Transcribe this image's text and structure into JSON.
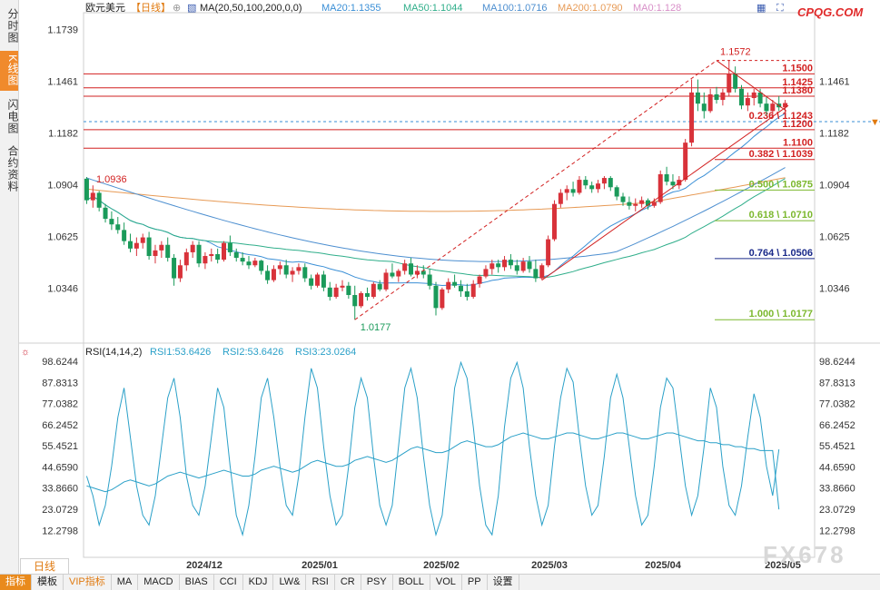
{
  "header": {
    "symbol": "欧元美元",
    "period_label": "【日线】",
    "ma_label": "MA(20,50,100,200,0,0)",
    "ma_values": [
      "MA20:1.1355",
      "MA50:1.1044",
      "MA100:1.0716",
      "MA200:1.0790",
      "MA0:1.128"
    ],
    "logo": "CPQG.COM",
    "rsi_label": "RSI(14,14,2)",
    "rsi_values": [
      "RSI1:53.6426",
      "RSI2:53.6426",
      "RSI3:23.0264"
    ]
  },
  "left_tabs": [
    "分时图",
    "K线图",
    "闪电图",
    "合约资料"
  ],
  "period_tab": "日线",
  "toolbar": [
    "指标",
    "模板",
    "VIP指标",
    "MA",
    "MACD",
    "BIAS",
    "CCI",
    "KDJ",
    "LW&",
    "RSI",
    "CR",
    "PSY",
    "BOLL",
    "VOL",
    "PP",
    "设置"
  ],
  "watermark": "FX678",
  "colors": {
    "up": "#d8323a",
    "down": "#1a9a5a",
    "ma20": "#3a8fd6",
    "ma50": "#2fae8a",
    "ma100": "#4d8fd0",
    "ma200": "#e79a55",
    "fib_line": "#d22020",
    "fib_0.5": "#7cb82e",
    "fib_0.764": "#1a2a8a",
    "logo": "#e02a2a",
    "rsi": "#2aa0c8"
  },
  "chart_data": [
    {
      "type": "candlestick",
      "title": "欧元美元 日线",
      "x_labels": [
        "2024/12",
        "2025/01",
        "2025/02",
        "2025/03",
        "2025/04",
        "2025/05"
      ],
      "y_ticks": [
        "1.1739",
        "1.1461",
        "1.1182",
        "1.0904",
        "1.0625",
        "1.0346"
      ],
      "ylim": [
        1.01,
        1.18
      ],
      "annotations": {
        "high": "1.1572",
        "low": "1.0177",
        "start": "1.0936"
      },
      "ohlc": [
        [
          1.0936,
          1.0945,
          1.08,
          1.082
        ],
        [
          1.082,
          1.09,
          1.078,
          1.086
        ],
        [
          1.086,
          1.087,
          1.076,
          1.078
        ],
        [
          1.078,
          1.08,
          1.07,
          1.072
        ],
        [
          1.072,
          1.076,
          1.066,
          1.069
        ],
        [
          1.069,
          1.073,
          1.064,
          1.066
        ],
        [
          1.066,
          1.07,
          1.058,
          1.06
        ],
        [
          1.06,
          1.064,
          1.054,
          1.056
        ],
        [
          1.056,
          1.062,
          1.052,
          1.059
        ],
        [
          1.059,
          1.064,
          1.056,
          1.062
        ],
        [
          1.062,
          1.065,
          1.05,
          1.052
        ],
        [
          1.052,
          1.058,
          1.048,
          1.055
        ],
        [
          1.055,
          1.06,
          1.051,
          1.058
        ],
        [
          1.058,
          1.062,
          1.049,
          1.051
        ],
        [
          1.051,
          1.053,
          1.036,
          1.04
        ],
        [
          1.04,
          1.05,
          1.038,
          1.047
        ],
        [
          1.047,
          1.056,
          1.044,
          1.054
        ],
        [
          1.054,
          1.06,
          1.051,
          1.058
        ],
        [
          1.058,
          1.06,
          1.046,
          1.048
        ],
        [
          1.048,
          1.054,
          1.045,
          1.052
        ],
        [
          1.052,
          1.056,
          1.049,
          1.053
        ],
        [
          1.053,
          1.056,
          1.048,
          1.05
        ],
        [
          1.05,
          1.06,
          1.049,
          1.059
        ],
        [
          1.059,
          1.063,
          1.052,
          1.054
        ],
        [
          1.054,
          1.056,
          1.049,
          1.051
        ],
        [
          1.051,
          1.054,
          1.047,
          1.049
        ],
        [
          1.049,
          1.052,
          1.045,
          1.047
        ],
        [
          1.047,
          1.051,
          1.046,
          1.0495
        ],
        [
          1.0495,
          1.05,
          1.042,
          1.044
        ],
        [
          1.044,
          1.047,
          1.037,
          1.039
        ],
        [
          1.039,
          1.047,
          1.038,
          1.045
        ],
        [
          1.045,
          1.049,
          1.042,
          1.047
        ],
        [
          1.047,
          1.05,
          1.04,
          1.042
        ],
        [
          1.042,
          1.046,
          1.038,
          1.044
        ],
        [
          1.044,
          1.048,
          1.042,
          1.046
        ],
        [
          1.046,
          1.048,
          1.038,
          1.04
        ],
        [
          1.04,
          1.042,
          1.034,
          1.036
        ],
        [
          1.036,
          1.043,
          1.035,
          1.042
        ],
        [
          1.042,
          1.044,
          1.033,
          1.035
        ],
        [
          1.035,
          1.038,
          1.028,
          1.03
        ],
        [
          1.03,
          1.037,
          1.029,
          1.035
        ],
        [
          1.035,
          1.039,
          1.033,
          1.036
        ],
        [
          1.036,
          1.038,
          1.029,
          1.031
        ],
        [
          1.031,
          1.036,
          1.0177,
          1.025
        ],
        [
          1.025,
          1.033,
          1.024,
          1.032
        ],
        [
          1.032,
          1.035,
          1.028,
          1.03
        ],
        [
          1.03,
          1.038,
          1.029,
          1.037
        ],
        [
          1.037,
          1.039,
          1.033,
          1.034
        ],
        [
          1.034,
          1.045,
          1.033,
          1.043
        ],
        [
          1.043,
          1.048,
          1.04,
          1.041
        ],
        [
          1.041,
          1.045,
          1.038,
          1.044
        ],
        [
          1.044,
          1.05,
          1.042,
          1.048
        ],
        [
          1.048,
          1.051,
          1.041,
          1.042
        ],
        [
          1.042,
          1.047,
          1.04,
          1.044
        ],
        [
          1.044,
          1.047,
          1.04,
          1.042
        ],
        [
          1.042,
          1.045,
          1.034,
          1.036
        ],
        [
          1.036,
          1.038,
          1.02,
          1.024
        ],
        [
          1.024,
          1.035,
          1.023,
          1.034
        ],
        [
          1.034,
          1.04,
          1.032,
          1.038
        ],
        [
          1.038,
          1.042,
          1.035,
          1.036
        ],
        [
          1.036,
          1.039,
          1.03,
          1.033
        ],
        [
          1.033,
          1.037,
          1.028,
          1.03
        ],
        [
          1.03,
          1.039,
          1.029,
          1.037
        ],
        [
          1.037,
          1.042,
          1.035,
          1.041
        ],
        [
          1.041,
          1.047,
          1.04,
          1.045
        ],
        [
          1.045,
          1.05,
          1.042,
          1.048
        ],
        [
          1.048,
          1.05,
          1.043,
          1.046
        ],
        [
          1.046,
          1.052,
          1.044,
          1.05
        ],
        [
          1.05,
          1.053,
          1.045,
          1.047
        ],
        [
          1.047,
          1.05,
          1.042,
          1.044
        ],
        [
          1.044,
          1.051,
          1.043,
          1.049
        ],
        [
          1.049,
          1.052,
          1.043,
          1.045
        ],
        [
          1.045,
          1.05,
          1.038,
          1.04
        ],
        [
          1.04,
          1.048,
          1.039,
          1.047
        ],
        [
          1.047,
          1.063,
          1.046,
          1.061
        ],
        [
          1.061,
          1.082,
          1.06,
          1.08
        ],
        [
          1.08,
          1.088,
          1.078,
          1.086
        ],
        [
          1.086,
          1.09,
          1.082,
          1.088
        ],
        [
          1.088,
          1.092,
          1.084,
          1.086
        ],
        [
          1.086,
          1.095,
          1.085,
          1.093
        ],
        [
          1.093,
          1.095,
          1.088,
          1.09
        ],
        [
          1.09,
          1.092,
          1.086,
          1.088
        ],
        [
          1.088,
          1.093,
          1.086,
          1.091
        ],
        [
          1.091,
          1.095,
          1.088,
          1.094
        ],
        [
          1.094,
          1.095,
          1.087,
          1.089
        ],
        [
          1.089,
          1.09,
          1.082,
          1.084
        ],
        [
          1.084,
          1.086,
          1.079,
          1.081
        ],
        [
          1.081,
          1.084,
          1.077,
          1.079
        ],
        [
          1.079,
          1.083,
          1.076,
          1.08
        ],
        [
          1.08,
          1.084,
          1.078,
          1.082
        ],
        [
          1.082,
          1.083,
          1.077,
          1.079
        ],
        [
          1.079,
          1.083,
          1.078,
          1.081
        ],
        [
          1.081,
          1.098,
          1.08,
          1.096
        ],
        [
          1.096,
          1.1,
          1.09,
          1.092
        ],
        [
          1.092,
          1.096,
          1.088,
          1.09
        ],
        [
          1.09,
          1.095,
          1.088,
          1.093
        ],
        [
          1.093,
          1.115,
          1.092,
          1.113
        ],
        [
          1.113,
          1.147,
          1.111,
          1.14
        ],
        [
          1.14,
          1.147,
          1.13,
          1.134
        ],
        [
          1.134,
          1.14,
          1.126,
          1.13
        ],
        [
          1.13,
          1.142,
          1.129,
          1.139
        ],
        [
          1.139,
          1.143,
          1.134,
          1.136
        ],
        [
          1.136,
          1.142,
          1.133,
          1.14
        ],
        [
          1.14,
          1.1572,
          1.138,
          1.15
        ],
        [
          1.15,
          1.154,
          1.14,
          1.142
        ],
        [
          1.142,
          1.144,
          1.131,
          1.133
        ],
        [
          1.133,
          1.14,
          1.13,
          1.137
        ],
        [
          1.137,
          1.142,
          1.133,
          1.14
        ],
        [
          1.14,
          1.142,
          1.132,
          1.134
        ],
        [
          1.134,
          1.138,
          1.128,
          1.13
        ],
        [
          1.13,
          1.136,
          1.127,
          1.134
        ],
        [
          1.134,
          1.138,
          1.13,
          1.132
        ],
        [
          1.132,
          1.136,
          1.129,
          1.1343
        ]
      ]
    },
    {
      "type": "fibonacci",
      "levels": [
        {
          "label": "1.1500",
          "value": 1.15
        },
        {
          "label": "1.1425",
          "value": 1.1425
        },
        {
          "label": "1.1380",
          "value": 1.138
        },
        {
          "label": "0.236 \\ 1.1243",
          "value": 1.1243
        },
        {
          "label": "1.1200",
          "value": 1.12
        },
        {
          "label": "1.1100",
          "value": 1.11
        },
        {
          "label": "0.382 \\ 1.1039",
          "value": 1.1039
        },
        {
          "label": "0.500 \\ 1.0875",
          "value": 1.0875
        },
        {
          "label": "0.618 \\ 1.0710",
          "value": 1.071
        },
        {
          "label": "0.764 \\ 1.0506",
          "value": 1.0506
        },
        {
          "label": "1.000 \\ 1.0177",
          "value": 1.0177
        }
      ]
    },
    {
      "type": "line",
      "title": "RSI(14,14,2)",
      "y_ticks": [
        "98.6244",
        "87.8313",
        "77.0382",
        "66.2452",
        "55.4521",
        "44.6590",
        "33.8660",
        "23.0729",
        "12.2798"
      ],
      "ylim": [
        5,
        100
      ],
      "series": [
        {
          "name": "RSI1",
          "values": [
            40,
            30,
            15,
            25,
            45,
            70,
            85,
            60,
            35,
            20,
            15,
            30,
            55,
            80,
            90,
            70,
            40,
            25,
            20,
            35,
            60,
            85,
            75,
            45,
            20,
            10,
            25,
            50,
            80,
            90,
            70,
            45,
            25,
            20,
            40,
            70,
            95,
            85,
            55,
            30,
            15,
            20,
            45,
            75,
            90,
            80,
            50,
            25,
            15,
            25,
            55,
            85,
            95,
            80,
            50,
            25,
            10,
            20,
            50,
            85,
            98,
            90,
            65,
            35,
            15,
            10,
            30,
            65,
            90,
            98,
            85,
            55,
            30,
            15,
            25,
            55,
            80,
            95,
            88,
            60,
            35,
            20,
            25,
            50,
            80,
            92,
            80,
            55,
            30,
            15,
            20,
            45,
            75,
            90,
            85,
            60,
            35,
            20,
            30,
            55,
            85,
            75,
            45,
            25,
            20,
            35,
            60,
            82,
            70,
            45,
            30,
            53.6
          ]
        },
        {
          "name": "RSI3",
          "values": [
            35,
            34,
            33,
            32,
            33,
            35,
            37,
            38,
            37,
            36,
            35,
            36,
            38,
            40,
            41,
            42,
            41,
            40,
            39,
            40,
            41,
            42,
            43,
            42,
            41,
            40,
            40,
            41,
            43,
            44,
            45,
            44,
            43,
            42,
            43,
            45,
            47,
            48,
            47,
            46,
            45,
            45,
            46,
            48,
            49,
            50,
            49,
            48,
            47,
            48,
            50,
            52,
            54,
            55,
            54,
            53,
            52,
            52,
            53,
            55,
            57,
            58,
            57,
            56,
            55,
            55,
            56,
            58,
            60,
            61,
            62,
            61,
            60,
            59,
            59,
            60,
            61,
            62,
            62,
            61,
            60,
            59,
            59,
            60,
            61,
            62,
            62,
            61,
            60,
            59,
            59,
            60,
            61,
            62,
            62,
            61,
            60,
            59,
            58,
            58,
            57,
            57,
            56,
            56,
            55,
            55,
            54,
            54,
            53,
            53,
            53,
            23.0
          ]
        }
      ]
    }
  ]
}
